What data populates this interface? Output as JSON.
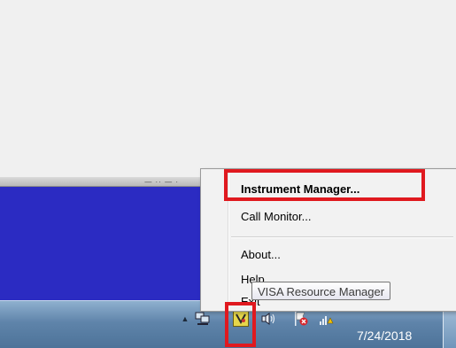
{
  "context_menu": {
    "items": [
      {
        "label": "Instrument Manager...",
        "bold": true
      },
      {
        "label": "Call Monitor..."
      },
      {
        "label": "About..."
      },
      {
        "label": "Help"
      },
      {
        "label": "Exit"
      }
    ]
  },
  "tooltip": {
    "text": "VISA Resource Manager"
  },
  "taskbar": {
    "date": "7/24/2018",
    "tray_icons": [
      "show-hidden-chevron-icon",
      "network-icon",
      "visa-resource-manager-icon",
      "speaker-icon",
      "action-center-flag-icon",
      "wireless-network-icon"
    ]
  },
  "highlight_color": "#e0191f",
  "colors": {
    "taskbar": "#5f84aa",
    "window_blue": "#2b2bc2",
    "menu_bg": "#f2f2f2"
  }
}
